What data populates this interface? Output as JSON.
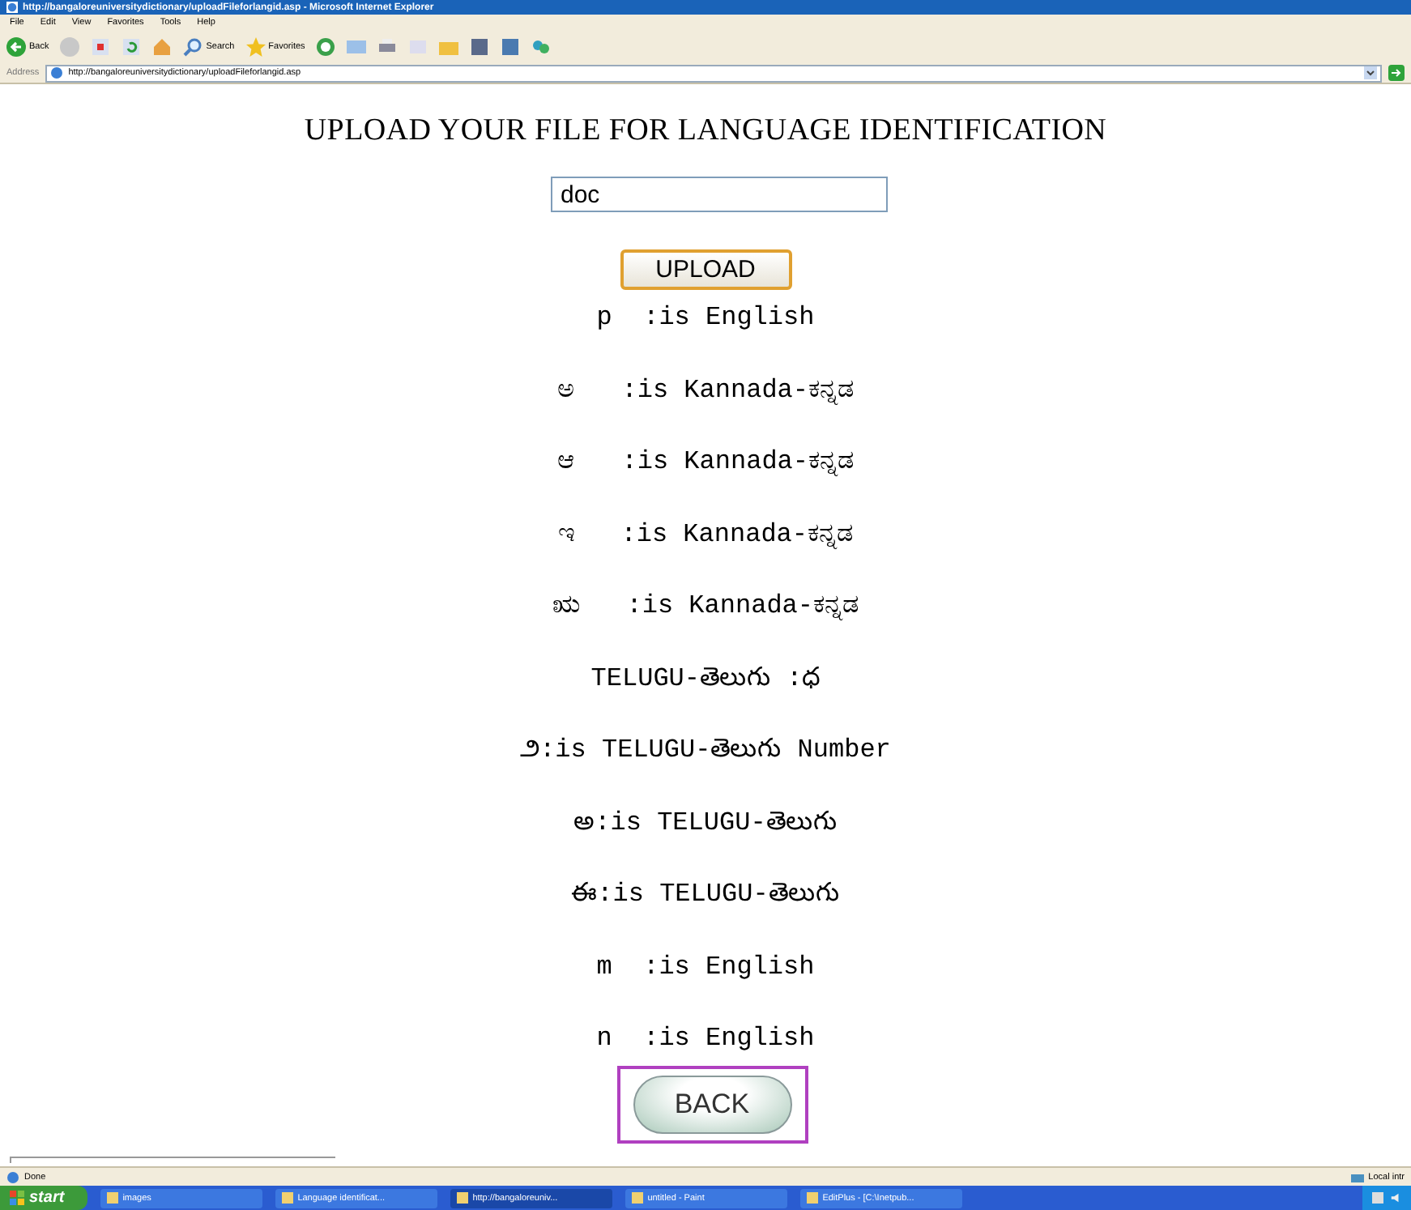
{
  "window": {
    "title": "http://bangaloreuniversitydictionary/uploadFileforlangid.asp - Microsoft Internet Explorer"
  },
  "menu": [
    "File",
    "Edit",
    "View",
    "Favorites",
    "Tools",
    "Help"
  ],
  "toolbar": {
    "back": "Back",
    "search": "Search",
    "favorites": "Favorites"
  },
  "address_bar": {
    "label": "Address",
    "url": "http://bangaloreuniversitydictionary/uploadFileforlangid.asp"
  },
  "page": {
    "heading": "UPLOAD YOUR FILE FOR LANGUAGE IDENTIFICATION",
    "file_field": {
      "value": "doc"
    },
    "upload_button": "UPLOAD",
    "results": [
      "p  :is English",
      "ಅ   :is Kannada-ಕನ್ನಡ",
      "ಆ   :is Kannada-ಕನ್ನಡ",
      "ಇ   :is Kannada-ಕನ್ನಡ",
      "ಋ   :is Kannada-ಕನ್ನಡ",
      "TELUGU-తెలుగు :ధ",
      "౨:is TELUGU-తెలుగు Number",
      "అ:is TELUGU-తెలుగు",
      "ఈ:is TELUGU-తెలుగు",
      "m  :is English",
      "n  :is English"
    ],
    "back_button": "BACK"
  },
  "status_bar": {
    "status": "Done",
    "zone": "Local intr"
  },
  "taskbar": {
    "start": "start",
    "tasks": [
      {
        "label": "images",
        "selected": false
      },
      {
        "label": "Language identificat...",
        "selected": false
      },
      {
        "label": "http://bangaloreuniv...",
        "selected": true
      },
      {
        "label": "untitled - Paint",
        "selected": false
      },
      {
        "label": "EditPlus - [C:\\Inetpub...",
        "selected": false
      }
    ]
  }
}
